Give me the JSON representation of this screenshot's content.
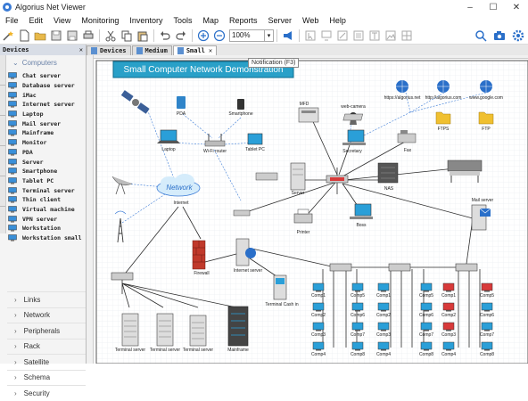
{
  "window": {
    "title": "Algorius Net Viewer",
    "controls": [
      "–",
      "☐",
      "✕"
    ]
  },
  "menu": [
    "File",
    "Edit",
    "View",
    "Monitoring",
    "Inventory",
    "Tools",
    "Map",
    "Reports",
    "Server",
    "Web",
    "Help"
  ],
  "toolbar": {
    "zoom": "100%",
    "tooltip": "Notification (F3)"
  },
  "left_panel": {
    "title": "Devices",
    "open_category": "Computers",
    "devices": [
      "Chat server",
      "Database server",
      "iMac",
      "Internet server",
      "Laptop",
      "Mail server",
      "Mainframe",
      "Monitor",
      "PDA",
      "Server",
      "Smartphone",
      "Tablet PC",
      "Terminal server",
      "Thin client",
      "Virtual machine",
      "VPN server",
      "Workstation",
      "Workstation small"
    ],
    "categories": [
      "Links",
      "Network",
      "Peripherals",
      "Rack",
      "Satellite",
      "Schema",
      "Security"
    ]
  },
  "tabs": [
    {
      "label": "Devices",
      "active": false
    },
    {
      "label": "Medium",
      "active": false
    },
    {
      "label": "Small",
      "active": true
    }
  ],
  "diagram": {
    "title": "Small Computer Network Demonstration",
    "labels": {
      "pda": "PDA",
      "smartphone": "Smartphone",
      "mfd": "MFD",
      "webcam": "web-camera",
      "laptop": "Laptop",
      "wifi": "Wi-Fi router",
      "tablet": "Tablet PC",
      "secretary": "Secretary",
      "fax": "Fax",
      "network": "Network",
      "internet": "Internet",
      "server": "Server",
      "nas": "NAS",
      "printer": "Printer",
      "boss": "Boss",
      "mailserver": "Mail server",
      "firewall": "Firewall",
      "inetserver": "Internet server",
      "cash": "Terminal Cash in",
      "ts1": "Terminal server",
      "ts2": "Terminal server",
      "ts3": "Terminal server",
      "mainframe": "Mainframe",
      "site1": "https://algorius.net",
      "site2": "http://algorius.com",
      "site3": "www.google.com",
      "ftp1": "FTPS",
      "ftp2": "FTP"
    },
    "comps": {
      "col1": [
        "Comp1",
        "Comp2",
        "Comp3",
        "Comp4"
      ],
      "col2": [
        "Comp5",
        "Comp6",
        "Comp7",
        "Comp8"
      ],
      "col3": [
        "Comp1",
        "Comp2",
        "Comp3",
        "Comp4"
      ],
      "col4": [
        "Comp5",
        "Comp6",
        "Comp7",
        "Comp8"
      ],
      "col5": [
        "Comp1",
        "Comp2",
        "Comp3",
        "Comp4"
      ],
      "col6": [
        "Comp5",
        "Comp6",
        "Comp7",
        "Comp8"
      ]
    },
    "colors": {
      "monitor": "#2a9fd8",
      "alert": "#d83a3a",
      "link": "#2b2b2b",
      "wireless": "#3b7bd6"
    }
  }
}
